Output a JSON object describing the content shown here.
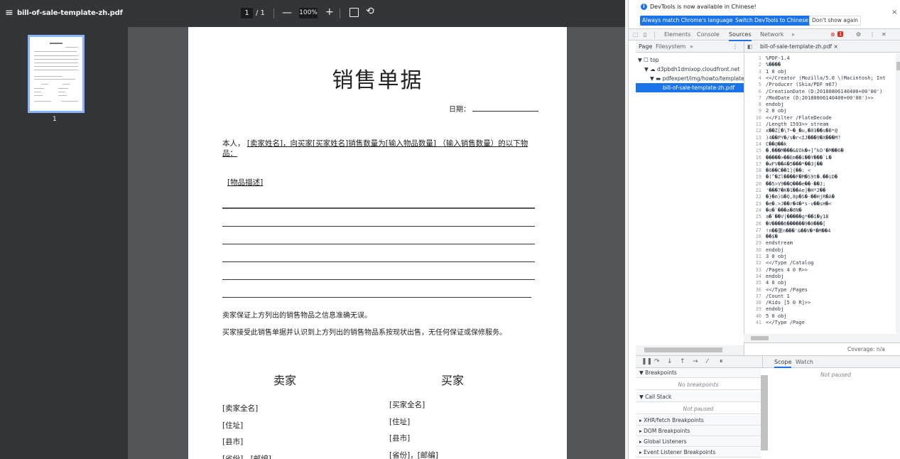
{
  "viewer": {
    "filename": "bill-of-sale-template-zh.pdf",
    "page_current": "1",
    "page_total": "/ 1",
    "zoom": "100%",
    "minus": "—",
    "plus": "+",
    "menu_glyph": "≡",
    "fit_glyph": "⊡",
    "rotate_glyph": "⟲",
    "thumb_label": "1"
  },
  "document": {
    "title": "销售单据",
    "date_label": "日期：",
    "para": "本人，",
    "para_underlined": "[卖家姓名]，向买家[买家姓名]销售数量为[输入物品数量] （输入销售数量）的以下物品：",
    "item_desc": "[物品描述]",
    "statement1": "卖家保证上方列出的销售物品之信息准确无误。",
    "statement2": "买家接受此销售单据并认识到上方列出的销售物品系按现状出售，无任何保证或保修服务。",
    "seller_heading": "卖家",
    "buyer_heading": "买家",
    "seller_fields": [
      "[卖家全名]",
      "[住址]",
      "[县市]",
      "[省份]，[邮编]"
    ],
    "buyer_fields": [
      "[买家全名]",
      "[住址]",
      "[县市]",
      "[省份]，[邮编]"
    ]
  },
  "devtools": {
    "info_message": "DevTools is now available in Chinese!",
    "btn_match": "Always match Chrome's language",
    "btn_switch": "Switch DevTools to Chinese",
    "btn_dont": "Don't show again",
    "close": "×",
    "tabs": [
      "Elements",
      "Console",
      "Sources",
      "Network",
      "»"
    ],
    "error_count": "1",
    "nav_tabs": [
      "Page",
      "Filesystem",
      "»"
    ],
    "tree": [
      "▼ ☐ top",
      "▼ ☁ d3pbdh1dmixop.cloudfront.net",
      "▼ ▬ pdfexpert/img/howto/template",
      "bill-of-sale-template-zh.pdf"
    ],
    "editor_tab": "bill-of-sale-template-zh.pdf ×",
    "code_lines": [
      "%PDF-1.4",
      "%����",
      "1 0 obj",
      "<</Creator (Mozilla/5.0 \\(Macintosh; Int",
      "/Producer (Skia/PDF m67)",
      "/CreationDate (D:20180806140400+00'00')",
      "/ModDate (D:20180806140400+00'00')>>",
      "endobj",
      "2 0 obj",
      "<</Filter /FlateDecode",
      "/Length 1593>> stream",
      "x��Z[�\\7~�_�u,�03��s�B*@",
      ")4��PY�/s�r<IJ���9�X���M?",
      "C��@��k",
      "�.���M���&EOk�+]^kO'�M��6�",
      "�����>��Em��i��Y���`L�",
      "�wFV��A�5���*��3|��",
      "�6��C��1]{��: <",
      "�(^�Zl����F�M�S9t�.��iD�",
      "��5>V9��Q���e��-��J;",
      "'���7�K�1��Ae]�H*2��",
      "�}�m)G�Q,8p�S�-��HjR�A�",
      "�e�.>J��r�4�*s-v��sH�<",
      "�o�`���a�8N�",
      "a�`��V|�����g*��1�y1B",
      "�V����6������9�0���[",
      "!n��重n���'&��V�*�M��4",
      "��$�",
      "endstream",
      "endobj",
      "3 0 obj",
      "<</Type /Catalog",
      "/Pages 4 0 R>>",
      "endobj",
      "4 0 obj",
      "<</Type /Pages",
      "/Count 1",
      "/Kids [5 0 R]>>",
      "endobj",
      "5 0 obj",
      "<</Type /Page"
    ],
    "coverage": "Coverage: n/a",
    "scope_tab": "Scope",
    "watch_tab": "Watch",
    "not_paused": "Not paused",
    "panes": [
      {
        "header": "▼ Breakpoints",
        "empty": "No breakpoints"
      },
      {
        "header": "▼ Call Stack",
        "empty": "Not paused"
      },
      {
        "header": "▸ XHR/fetch Breakpoints"
      },
      {
        "header": "▸ DOM Breakpoints"
      },
      {
        "header": "▸ Global Listeners"
      },
      {
        "header": "▸ Event Listener Breakpoints"
      }
    ]
  }
}
